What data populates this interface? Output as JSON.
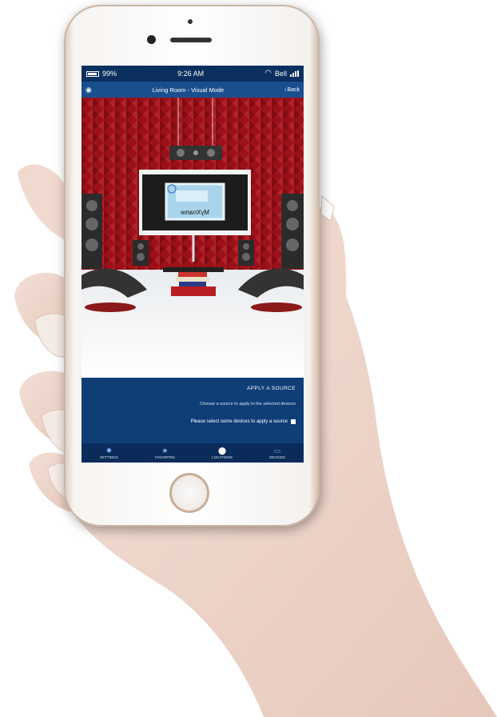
{
  "status_bar": {
    "battery": "99%",
    "time": "9:26 AM",
    "carrier": "Bell"
  },
  "nav_bar": {
    "title": "Living Room - Visual Mode",
    "back_label": "Back"
  },
  "room": {
    "tv_label": "MyXname"
  },
  "apply_source": {
    "title": "APPLY A SOURCE",
    "subtitle": "Choose a source to apply to the selected devices",
    "note": "Please select some devices to apply a source"
  },
  "tabs": [
    {
      "label": "SETTINGS",
      "icon": "gear-icon"
    },
    {
      "label": "FAVORITES",
      "icon": "star-icon"
    },
    {
      "label": "LOCATIONS",
      "icon": "location-pin-icon"
    },
    {
      "label": "DEVICES",
      "icon": "devices-icon",
      "active": true
    }
  ],
  "colors": {
    "screen_bg": "#0d3a72",
    "nav_bar": "#1a4f8f",
    "wall_red": "#9c1119",
    "accent_blue": "#5fa7ff"
  }
}
